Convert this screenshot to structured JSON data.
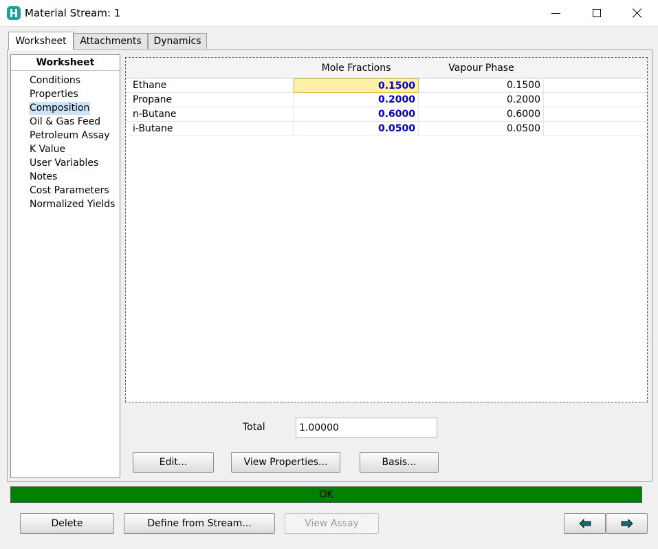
{
  "window": {
    "title": "Material Stream: 1"
  },
  "tabs": [
    {
      "label": "Worksheet",
      "active": true
    },
    {
      "label": "Attachments",
      "active": false
    },
    {
      "label": "Dynamics",
      "active": false
    }
  ],
  "sidebar": {
    "header": "Worksheet",
    "items": [
      {
        "label": "Conditions"
      },
      {
        "label": "Properties"
      },
      {
        "label": "Composition",
        "selected": true
      },
      {
        "label": "Oil & Gas Feed"
      },
      {
        "label": "Petroleum Assay"
      },
      {
        "label": "K Value"
      },
      {
        "label": "User Variables"
      },
      {
        "label": "Notes"
      },
      {
        "label": "Cost Parameters"
      },
      {
        "label": "Normalized Yields"
      }
    ]
  },
  "grid": {
    "columns": [
      "Mole Fractions",
      "Vapour Phase"
    ],
    "rows": [
      {
        "name": "Ethane",
        "mole_fraction": "0.1500",
        "vapour": "0.1500"
      },
      {
        "name": "Propane",
        "mole_fraction": "0.2000",
        "vapour": "0.2000"
      },
      {
        "name": "n-Butane",
        "mole_fraction": "0.6000",
        "vapour": "0.6000"
      },
      {
        "name": "i-Butane",
        "mole_fraction": "0.0500",
        "vapour": "0.0500"
      }
    ]
  },
  "total": {
    "label": "Total",
    "value": "1.00000"
  },
  "buttons": {
    "edit": "Edit...",
    "view_properties": "View Properties...",
    "basis": "Basis...",
    "delete": "Delete",
    "define_from_stream": "Define from Stream...",
    "view_assay": "View Assay"
  },
  "status": {
    "text": "OK",
    "color": "#008000"
  },
  "colors": {
    "specified_value": "#0000cc",
    "selected_cell": "#fff2a8",
    "arrow": "#0f6f6f"
  },
  "icons": {
    "app": "hysys-app-icon",
    "prev": "arrow-left-icon",
    "next": "arrow-right-icon"
  }
}
